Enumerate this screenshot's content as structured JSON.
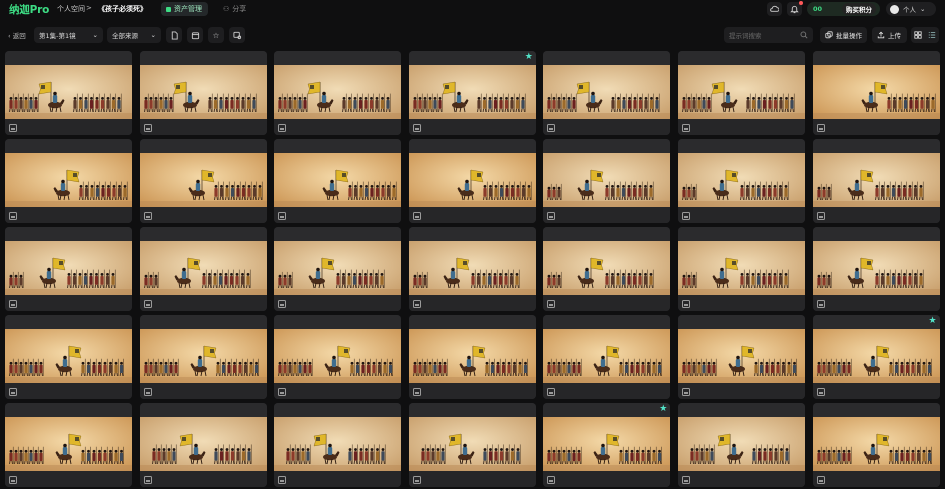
{
  "app": {
    "logo_main": "纳迦",
    "logo_suffix": "Pro",
    "brand_color": "#3ddc84"
  },
  "breadcrumb": {
    "space": "个人空间",
    "separator": ">",
    "project": "《孩子必须死》"
  },
  "tabs": [
    {
      "label": "资产管理",
      "active": true
    },
    {
      "label": "分享",
      "active": false
    }
  ],
  "header": {
    "icon1": "cloud-icon",
    "icon2": "bell-icon",
    "credits_value": "00",
    "buy_label": "购买积分",
    "user_label": "个人"
  },
  "toolbar": {
    "back_label": "返回",
    "episode_select": "第1集-第1镜",
    "source_select": "全部来源",
    "search_placeholder": "提示词搜索",
    "bulk_label": "批量操作",
    "upload_label": "上传"
  },
  "grid": {
    "columns": 7,
    "rows": 5,
    "starred": [
      3,
      27,
      32
    ],
    "variant_pattern": [
      0,
      0,
      0,
      0,
      0,
      0,
      1,
      1,
      1,
      1,
      1,
      2,
      2,
      2,
      2,
      2,
      2,
      2,
      2,
      2,
      2,
      3,
      3,
      3,
      3,
      3,
      3,
      3,
      3,
      4,
      4,
      4,
      3,
      4,
      3
    ]
  }
}
